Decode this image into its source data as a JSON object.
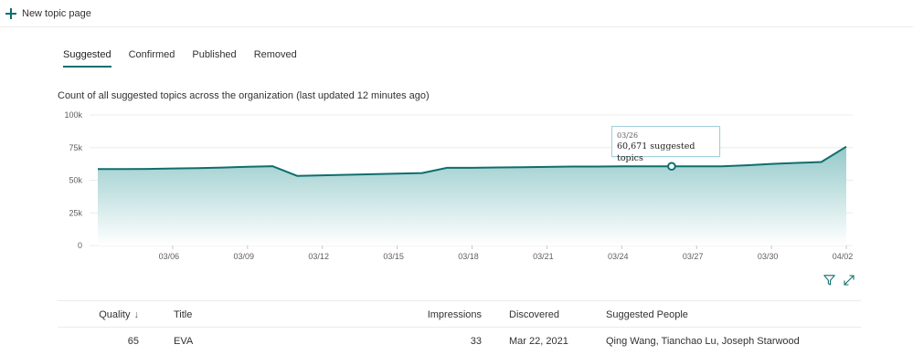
{
  "command_bar": {
    "new_topic_label": "New topic page"
  },
  "tabs": [
    {
      "label": "Suggested",
      "active": true
    },
    {
      "label": "Confirmed",
      "active": false
    },
    {
      "label": "Published",
      "active": false
    },
    {
      "label": "Removed",
      "active": false
    }
  ],
  "chart_caption": "Count of all suggested topics across the organization (last updated 12 minutes ago)",
  "tooltip": {
    "date": "03/26",
    "value": "60,671 suggested topics"
  },
  "colors": {
    "accent": "#0f6e6e",
    "area_top": "#94c9c9",
    "area_bottom": "#ffffff",
    "grid": "#edebe9",
    "tooltip_border": "#9fd0dc"
  },
  "chart_data": {
    "type": "area",
    "title": "",
    "xlabel": "",
    "ylabel": "",
    "ylim": [
      0,
      100000
    ],
    "y_ticks": [
      "0",
      "25k",
      "50k",
      "75k",
      "100k"
    ],
    "y_tick_values": [
      0,
      25000,
      50000,
      75000,
      100000
    ],
    "x_tick_labels": [
      "03/06",
      "03/09",
      "03/12",
      "03/15",
      "03/18",
      "03/21",
      "03/24",
      "03/27",
      "03/30",
      "04/02"
    ],
    "x_tick_days": [
      6,
      9,
      12,
      15,
      18,
      21,
      24,
      27,
      30,
      33
    ],
    "grid": true,
    "series": [
      {
        "x_days": [
          3,
          4,
          5,
          6,
          7,
          8,
          9,
          10,
          11,
          12,
          13,
          14,
          15,
          16,
          17,
          18,
          19,
          20,
          21,
          22,
          23,
          24,
          25,
          26,
          27,
          28,
          29,
          30,
          31,
          32,
          33
        ],
        "values": [
          58500,
          58500,
          58700,
          59000,
          59300,
          59700,
          60300,
          60800,
          53300,
          53800,
          54200,
          54600,
          55000,
          55500,
          59500,
          59500,
          59800,
          60000,
          60200,
          60500,
          60500,
          60600,
          60600,
          60671,
          60671,
          60600,
          61500,
          62500,
          63300,
          64000,
          75700
        ]
      }
    ],
    "highlight": {
      "x_day": 26,
      "value": 60671
    }
  },
  "chart_tools": {
    "filter_icon": "filter-icon",
    "expand_icon": "expand-icon"
  },
  "table": {
    "headers": {
      "quality": "Quality",
      "sort_indicator": "↓",
      "title": "Title",
      "impressions": "Impressions",
      "discovered": "Discovered",
      "people": "Suggested People"
    },
    "rows": [
      {
        "quality": "65",
        "title": "EVA",
        "impressions": "33",
        "discovered": "Mar 22, 2021",
        "people": "Qing Wang,  Tianchao Lu,  Joseph Starwood"
      }
    ]
  }
}
